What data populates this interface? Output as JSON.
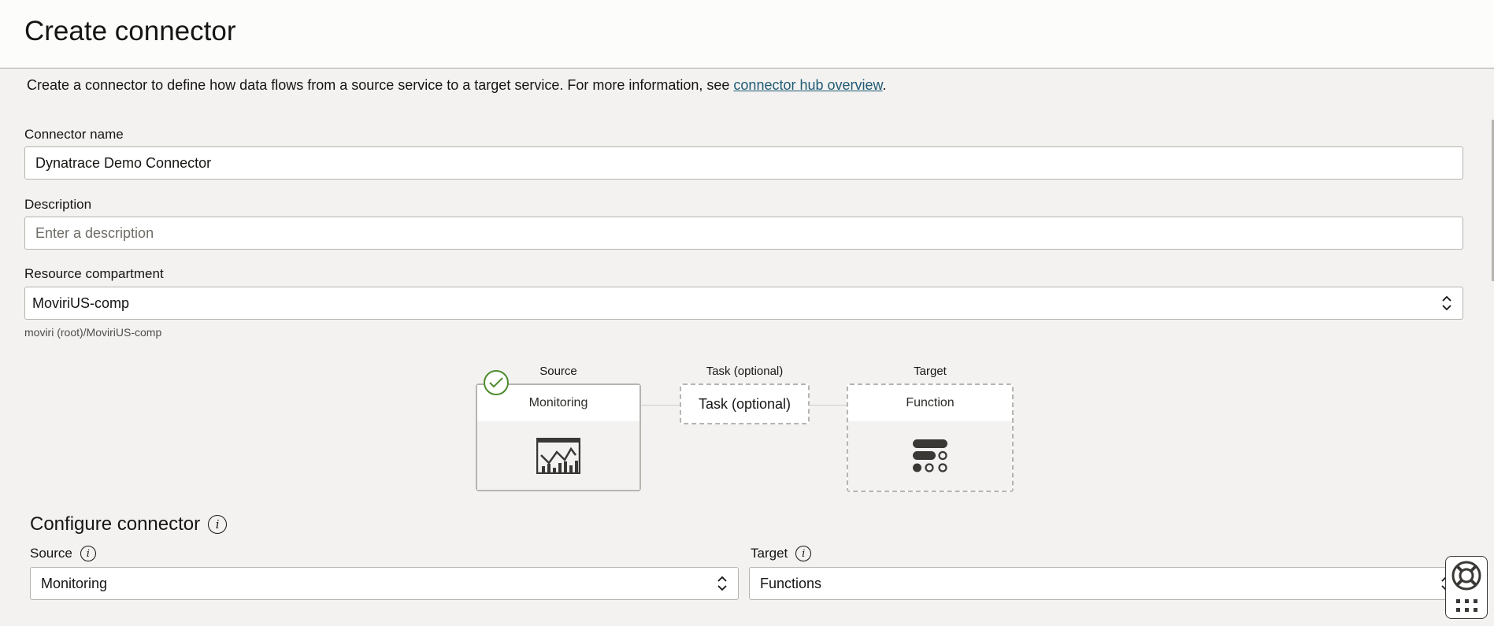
{
  "header": {
    "title": "Create connector"
  },
  "intro": {
    "text": "Create a connector to define how data flows from a source service to a target service. For more information, see ",
    "link": "connector hub overview",
    "suffix": "."
  },
  "form": {
    "connector_name": {
      "label": "Connector name",
      "value": "Dynatrace Demo Connector"
    },
    "description": {
      "label": "Description",
      "placeholder": "Enter a description",
      "value": ""
    },
    "compartment": {
      "label": "Resource compartment",
      "value": "MoviriUS-comp",
      "helper": "moviri (root)/MoviriUS-comp"
    }
  },
  "flow": {
    "source": {
      "title": "Source",
      "label": "Monitoring",
      "icon": "monitoring-chart-icon",
      "completed": true
    },
    "task": {
      "title": "Task (optional)",
      "label": "Task (optional)"
    },
    "target": {
      "title": "Target",
      "label": "Function",
      "icon": "function-icon"
    }
  },
  "configure": {
    "title": "Configure connector",
    "source": {
      "label": "Source",
      "value": "Monitoring"
    },
    "target": {
      "label": "Target",
      "value": "Functions"
    }
  },
  "colors": {
    "link": "#1f5a73",
    "success": "#4e8b2e",
    "background": "#f3f2f1"
  }
}
